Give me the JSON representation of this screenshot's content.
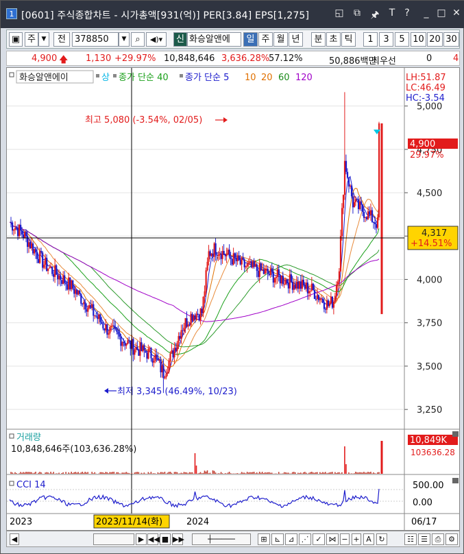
{
  "window": {
    "title": "[0601] 주식종합차트 - 시가총액[931(억)] PER[3.84] EPS[1,275]",
    "app_icon": "1",
    "controls": [
      "◱",
      "⧉",
      "🖈",
      "T",
      "?",
      "_",
      "□",
      "✕"
    ]
  },
  "toolbar": {
    "market": "주",
    "prev": "전",
    "code": "378850",
    "name_badge": "신",
    "stock_name": "화승알앤에",
    "periods": [
      "일",
      "주",
      "월",
      "년",
      "분",
      "초",
      "틱"
    ],
    "selected_period": "일",
    "intervals": [
      "1",
      "3",
      "5",
      "10",
      "20",
      "30"
    ]
  },
  "quote": {
    "price": "4,900",
    "change": "1,130",
    "change_pct": "+29.97%",
    "volume": "10,848,646",
    "volume_pct": "3,636.28%",
    "turnover": "57.12%",
    "amount": "50,886백만",
    "best_label": "최우선",
    "best_value": "0",
    "extra": "4"
  },
  "legend": {
    "name": "화승알앤에이",
    "items": [
      {
        "label": "상",
        "color": "#00b4e6"
      },
      {
        "label": "종가 단순 40",
        "color": "#1aa01a"
      },
      {
        "label": "종가 단순 5",
        "color": "#1a1acc"
      },
      {
        "label": "10",
        "color": "#e07000"
      },
      {
        "label": "20",
        "color": "#e07000"
      },
      {
        "label": "60",
        "color": "#1a8a1a"
      },
      {
        "label": "120",
        "color": "#a000c8"
      }
    ]
  },
  "info_box": {
    "lh": "LH:51.87",
    "lc": "LC:46.49",
    "hc": "HC:-3.54"
  },
  "annotations": {
    "high": "최고 5,080 (-3.54%, 02/05)",
    "low": "최저 3,345 (46.49%, 10/23)"
  },
  "price_tags": {
    "last_price": "4,900",
    "last_pct": "29.97%",
    "cursor_price": "4,317",
    "cursor_pct": "+14.51%"
  },
  "volume_panel": {
    "label": "거래량",
    "readout": "10,848,646주(103,636.28%)",
    "tag_value": "10,849K",
    "tag_pct": "103636.28"
  },
  "cci_panel": {
    "label": "CCI 14",
    "ticks": [
      "500.00",
      "0.00"
    ]
  },
  "x_axis": {
    "labels": [
      "2023",
      "2024",
      "06/17"
    ],
    "cursor_date": "2023/11/14(화)"
  },
  "chart_data": {
    "type": "candlestick",
    "y_ticks": [
      5000,
      4750,
      4500,
      4250,
      4000,
      3750,
      3500,
      3250
    ],
    "y_tick_labels": [
      "5,000",
      "4,750",
      "4,500",
      "4,250",
      "4,000",
      "3,750",
      "3,500",
      "3,250"
    ],
    "ylim": [
      3140,
      5220
    ],
    "high": 5080,
    "low": 3345,
    "last": 4900,
    "cursor_value": 4317
  },
  "colors": {
    "up": "#e21b1b",
    "down": "#1c1ccc",
    "accent": "#2e6fd1"
  }
}
